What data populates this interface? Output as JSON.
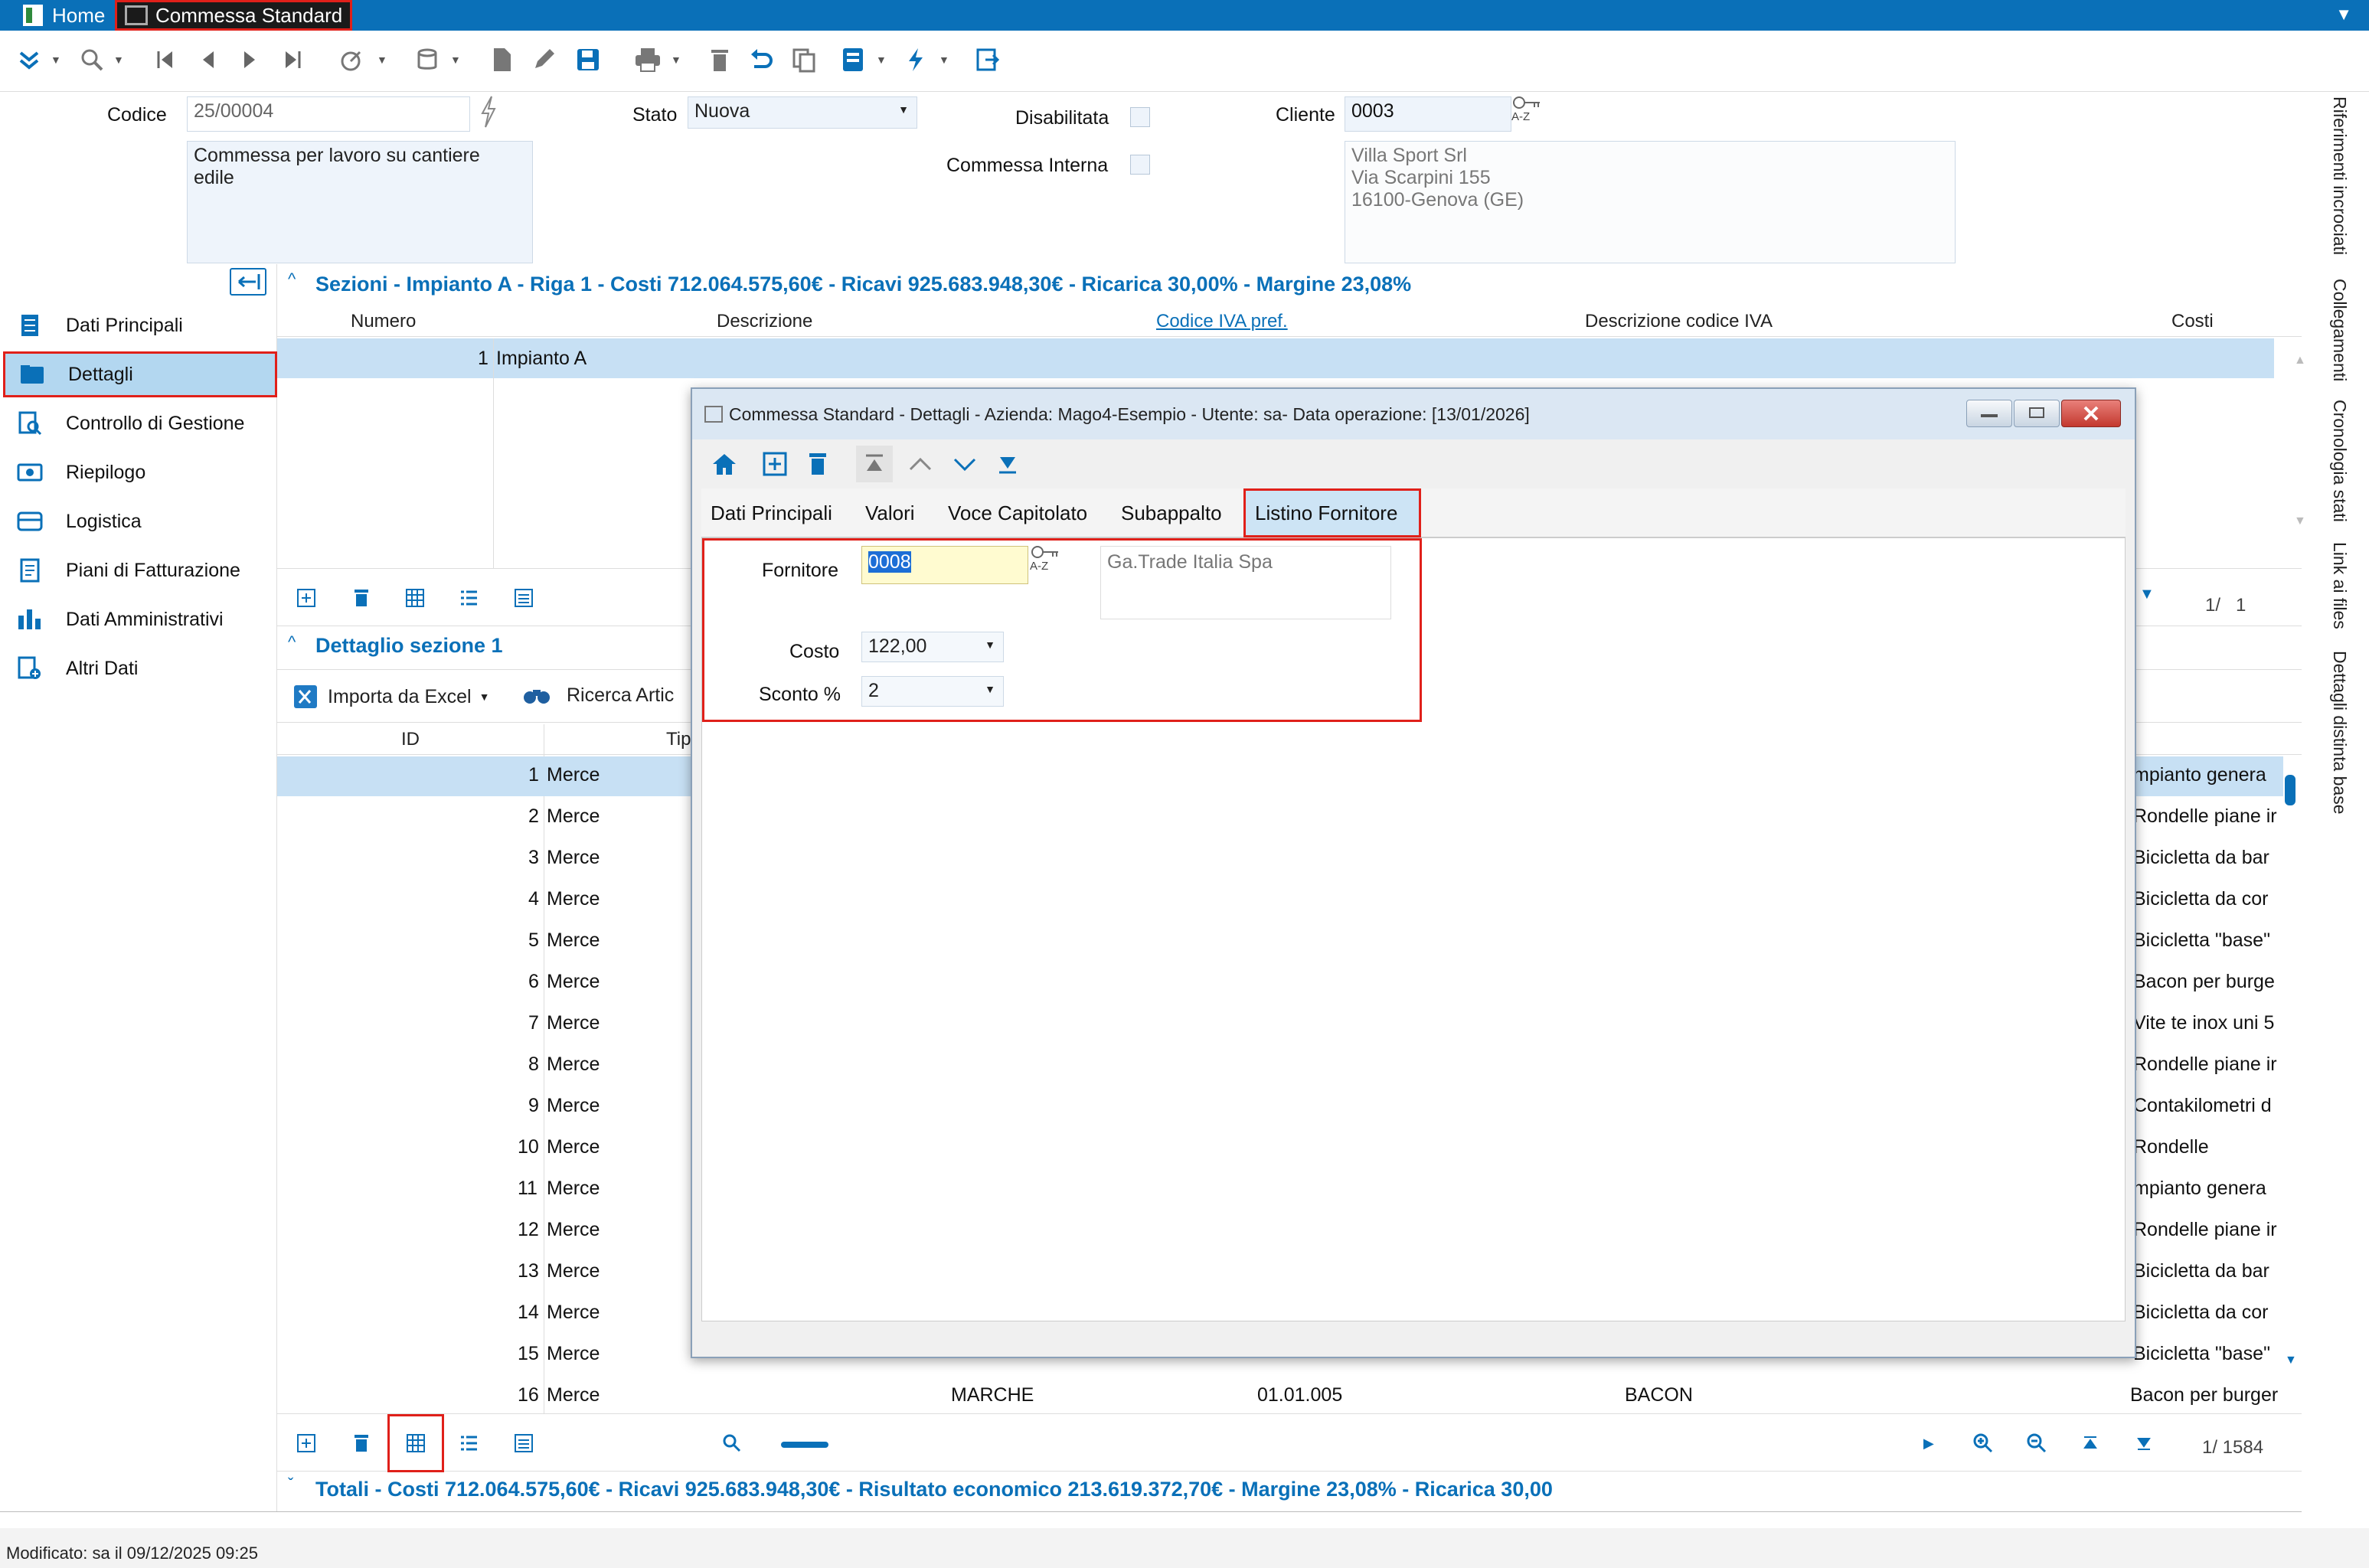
{
  "titlebar": {
    "tabs": [
      {
        "label": "Home"
      },
      {
        "label": "Commessa Standard"
      }
    ]
  },
  "header": {
    "codice_label": "Codice",
    "codice_value": "25/00004",
    "stato_label": "Stato",
    "stato_value": "Nuova",
    "disabilitata_label": "Disabilitata",
    "commessa_interna_label": "Commessa Interna",
    "cliente_label": "Cliente",
    "cliente_code": "0003",
    "descrizione_line1": "Commessa per lavoro su cantiere",
    "descrizione_line2": "edile",
    "cliente_addr1": "Villa Sport Srl",
    "cliente_addr2": "Via Scarpini 155",
    "cliente_addr3": "16100-Genova (GE)",
    "az_label": "A-Z"
  },
  "right_sidebar": {
    "items": [
      "Riferimenti incrociati",
      "Collegamenti",
      "Cronologia stati",
      "Link ai files",
      "Dettagli distinta base"
    ]
  },
  "nav": {
    "items": [
      {
        "label": "Dati Principali"
      },
      {
        "label": "Dettagli"
      },
      {
        "label": "Controllo di Gestione"
      },
      {
        "label": "Riepilogo"
      },
      {
        "label": "Logistica"
      },
      {
        "label": "Piani di Fatturazione"
      },
      {
        "label": "Dati Amministrativi"
      },
      {
        "label": "Altri Dati"
      }
    ]
  },
  "sezioni": {
    "title": "Sezioni - Impianto A - Riga 1 - Costi 712.064.575,60€ - Ricavi 925.683.948,30€ - Ricarica 30,00% - Margine 23,08%",
    "columns": [
      "Numero",
      "Descrizione",
      "Codice IVA pref.",
      "Descrizione codice IVA",
      "Costi"
    ],
    "row": {
      "numero": "1",
      "descrizione": "Impianto A"
    },
    "pager": "1/   1"
  },
  "dettaglio": {
    "title": "Dettaglio sezione 1",
    "import_label": "Importa da Excel",
    "ricerca_label": "Ricerca Artic",
    "col_id": "ID",
    "col_tipo": "Tip",
    "rows": [
      {
        "id": "1",
        "tipo": "Merce",
        "desc": "mpianto genera"
      },
      {
        "id": "2",
        "tipo": "Merce",
        "desc": "Rondelle piane ir"
      },
      {
        "id": "3",
        "tipo": "Merce",
        "desc": "Bicicletta da bar"
      },
      {
        "id": "4",
        "tipo": "Merce",
        "desc": "Bicicletta da cor"
      },
      {
        "id": "5",
        "tipo": "Merce",
        "desc": "Bicicletta  \"base\""
      },
      {
        "id": "6",
        "tipo": "Merce",
        "desc": "Bacon per burge"
      },
      {
        "id": "7",
        "tipo": "Merce",
        "desc": "Vite te inox uni 5"
      },
      {
        "id": "8",
        "tipo": "Merce",
        "desc": "Rondelle piane ir"
      },
      {
        "id": "9",
        "tipo": "Merce",
        "desc": "Contakilometri d"
      },
      {
        "id": "10",
        "tipo": "Merce",
        "desc": "Rondelle"
      },
      {
        "id": "11",
        "tipo": "Merce",
        "desc": "mpianto genera"
      },
      {
        "id": "12",
        "tipo": "Merce",
        "desc": "Rondelle piane ir"
      },
      {
        "id": "13",
        "tipo": "Merce",
        "desc": "Bicicletta da bar"
      },
      {
        "id": "14",
        "tipo": "Merce",
        "desc": "Bicicletta da cor"
      },
      {
        "id": "15",
        "tipo": "Merce",
        "desc": "Bicicletta  \"base\""
      },
      {
        "id": "16",
        "tipo": "Merce",
        "desc": "Bacon per burger"
      }
    ],
    "row16_extra": {
      "marca": "MARCHE",
      "data": "01.01.005",
      "cat": "BACON"
    },
    "pager": "1/ 1584"
  },
  "totali": {
    "title": "Totali - Costi 712.064.575,60€ - Ricavi 925.683.948,30€ - Risultato economico 213.619.372,70€ - Margine 23,08% - Ricarica 30,00"
  },
  "status": {
    "modificato": "Modificato: sa il 09/12/2025 09:25"
  },
  "dialog": {
    "title": "Commessa Standard - Dettagli - Azienda: Mago4-Esempio - Utente: sa- Data operazione: [13/01/2026]",
    "tabs": [
      {
        "label": "Dati Principali"
      },
      {
        "label": "Valori"
      },
      {
        "label": "Voce Capitolato"
      },
      {
        "label": "Subappalto"
      },
      {
        "label": "Listino Fornitore"
      }
    ],
    "fornitore_label": "Fornitore",
    "fornitore_code": "0008",
    "fornitore_name": "Ga.Trade Italia Spa",
    "costo_label": "Costo",
    "costo_value": "122,00",
    "sconto_label": "Sconto %",
    "sconto_value": "2"
  }
}
